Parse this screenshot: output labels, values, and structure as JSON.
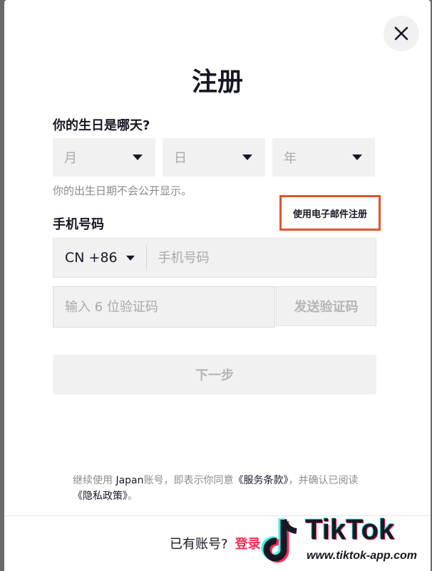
{
  "title": "注册",
  "birthday": {
    "label": "你的生日是哪天?",
    "month_placeholder": "月",
    "day_placeholder": "日",
    "year_placeholder": "年",
    "hint": "你的出生日期不会公开显示。"
  },
  "phone": {
    "label": "手机号码",
    "email_link": "使用电子邮件注册",
    "country_code": "CN +86",
    "placeholder": "手机号码"
  },
  "code": {
    "placeholder": "输入 6 位验证码",
    "send_label": "发送验证码"
  },
  "next_label": "下一步",
  "terms": {
    "part1": "继续使用 ",
    "app_name": "Japan",
    "part2": "账号，即表示你同意",
    "service_link": "《服务条款》",
    "part3": "，并确认已阅读",
    "privacy_link": "《隐私政策》",
    "part4": "。"
  },
  "footer": {
    "prompt": "已有账号?",
    "login_label": "登录"
  },
  "watermark": {
    "brand": "TikTok",
    "url": "www.tiktok-app.com"
  },
  "colors": {
    "accent": "#fe2c55",
    "highlight_box": "#e0542c",
    "field_bg": "#f1f1f2"
  }
}
